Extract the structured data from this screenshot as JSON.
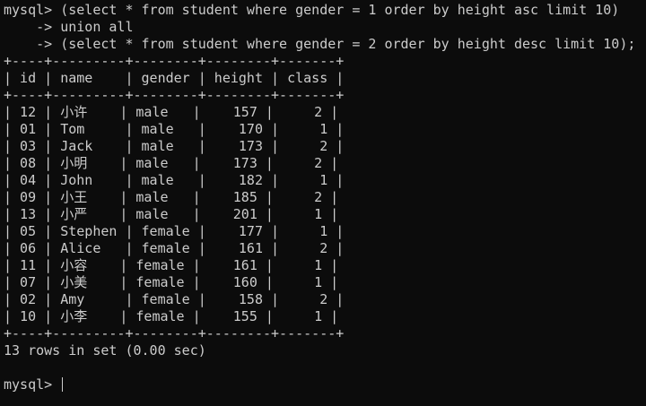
{
  "terminal": {
    "prompt": "mysql> ",
    "query_lines": [
      "mysql> (select * from student where gender = 1 order by height asc limit 10)",
      "    -> union all",
      "    -> (select * from student where gender = 2 order by height desc limit 10);"
    ],
    "table": {
      "border": "+----+---------+--------+--------+-------+",
      "header": "| id | name    | gender | height | class |",
      "rows": [
        "| 12 | 小许    | male   |    157 |     2 |",
        "| 01 | Tom     | male   |    170 |     1 |",
        "| 03 | Jack    | male   |    173 |     2 |",
        "| 08 | 小明    | male   |    173 |     2 |",
        "| 04 | John    | male   |    182 |     1 |",
        "| 09 | 小王    | male   |    185 |     2 |",
        "| 13 | 小严    | male   |    201 |     1 |",
        "| 05 | Stephen | female |    177 |     1 |",
        "| 06 | Alice   | female |    161 |     2 |",
        "| 11 | 小容    | female |    161 |     1 |",
        "| 07 | 小美    | female |    160 |     1 |",
        "| 02 | Amy     | female |    158 |     2 |",
        "| 10 | 小李    | female |    155 |     1 |"
      ]
    },
    "result_summary": "13 rows in set (0.00 sec)",
    "final_prompt": "mysql> "
  }
}
